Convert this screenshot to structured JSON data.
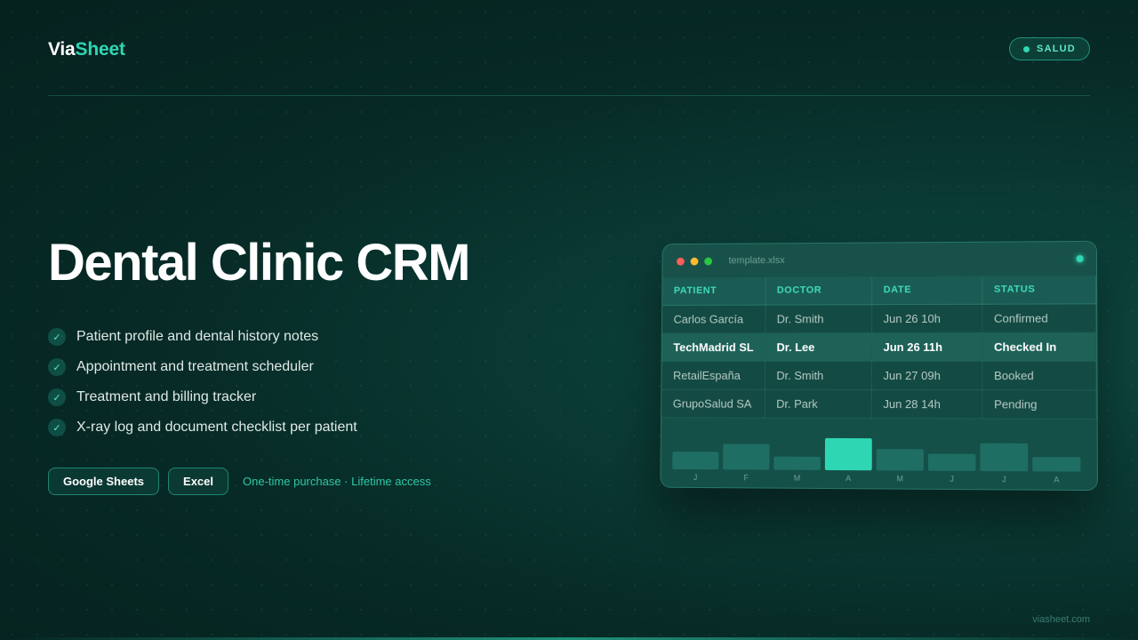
{
  "brand": {
    "part1": "Via",
    "part2": "Sheet"
  },
  "badge": {
    "label": "SALUD"
  },
  "title": "Dental Clinic CRM",
  "features": [
    "Patient profile and dental history notes",
    "Appointment and treatment scheduler",
    "Treatment and billing tracker",
    "X-ray log and document checklist per patient"
  ],
  "actions": {
    "google_sheets": "Google Sheets",
    "excel": "Excel",
    "note": "One-time purchase · Lifetime access"
  },
  "preview": {
    "filename": "template.xlsx",
    "columns": [
      "PATIENT",
      "DOCTOR",
      "DATE",
      "STATUS"
    ],
    "rows": [
      {
        "patient": "Carlos García",
        "doctor": "Dr. Smith",
        "date": "Jun 26 10h",
        "status": "Confirmed"
      },
      {
        "patient": "TechMadrid SL",
        "doctor": "Dr. Lee",
        "date": "Jun 26 11h",
        "status": "Checked In"
      },
      {
        "patient": "RetailEspaña",
        "doctor": "Dr. Smith",
        "date": "Jun 27 09h",
        "status": "Booked"
      },
      {
        "patient": "GrupoSalud SA",
        "doctor": "Dr. Park",
        "date": "Jun 28 14h",
        "status": "Pending"
      }
    ],
    "highlighted_row": 1,
    "window_dots": [
      "#ff5f57",
      "#febc2e",
      "#28c840"
    ]
  },
  "chart_data": {
    "type": "bar",
    "categories": [
      "J",
      "F",
      "M",
      "A",
      "M",
      "J",
      "J",
      "A"
    ],
    "values": [
      20,
      29,
      15,
      36,
      24,
      19,
      31,
      16
    ],
    "ylim": [
      0,
      40
    ],
    "highlight_index": 3
  },
  "footer": {
    "url": "viasheet.com"
  },
  "colors": {
    "accent": "#2fd6b4",
    "background": "#072a26"
  }
}
